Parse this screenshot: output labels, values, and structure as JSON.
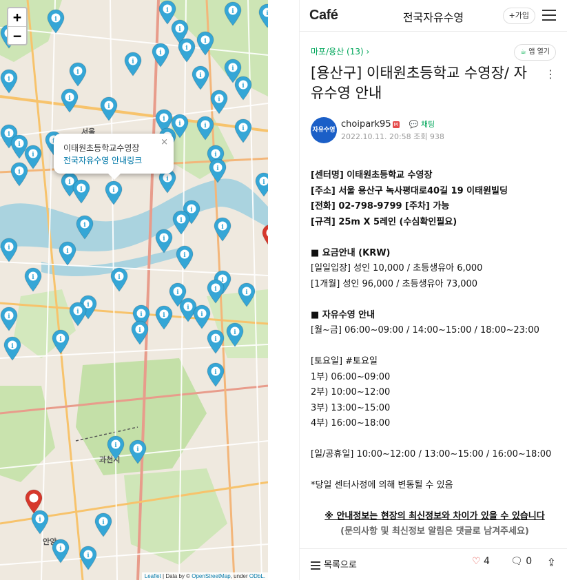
{
  "map": {
    "zoom_in": "+",
    "zoom_out": "−",
    "labels": {
      "seoul": "서울",
      "gwacheon": "과천시",
      "anyang": "안양"
    },
    "popup": {
      "line1": "이태원초등학교수영장",
      "line2": "전국자유수영 안내링크",
      "close": "×"
    },
    "attribution": {
      "leaflet": "Leaflet",
      "text": " | Data by © ",
      "osm": "OpenStreetMap",
      "under": ", under ",
      "odbl": "ODbL."
    },
    "marker_color": "#35a6d6",
    "selected_marker_color": "#d6382c"
  },
  "cafe": {
    "logo": "Café",
    "title": "전국자유수영",
    "join_label": "+가입",
    "board": "마포/용산 (13) ›",
    "open_app": "앱 열기",
    "post_title": "[용산구] 이태원초등학교 수영장/ 자유수영 안내",
    "avatar_text": "자유수영",
    "author": "choipark95",
    "author_badge": "M",
    "chat": "채팅",
    "date": "2022.10.11. 20:58 조회 938",
    "body": {
      "center": "[센터명] 이태원초등학교 수영장",
      "address": "[주소] 서울 용산구 녹사평대로40길 19 이태원빌딩",
      "phone": "[전화] 02-798-9799  [주차] 가능",
      "spec": "[규격] 25m X 5레인 (수심확인필요)",
      "fee_heading": "■ 요금안내 (KRW)",
      "fee_day": "[일일입장] 성인 10,000 / 초등생유아 6,000",
      "fee_month": "[1개월] 성인 96,000 / 초등생유아 73,000",
      "free_heading": "■ 자유수영 안내",
      "weekday": "[월~금] 06:00~09:00 / 14:00~15:00 / 18:00~23:00",
      "saturday": "[토요일] #토요일",
      "sat1": " 1부) 06:00~09:00",
      "sat2": " 2부) 10:00~12:00",
      "sat3": " 3부) 13:00~15:00",
      "sat4": " 4부) 16:00~18:00",
      "sunday": "[일/공휴일] 10:00~12:00 / 13:00~15:00 / 16:00~18:00",
      "note": "*당일 센터사정에 의해 변동될 수 있음",
      "notice": "※ 안내정보는 현장의 최신정보와 차이가 있을 수 있습니다",
      "notice2": "(문의사항 및 최신정보 알림은 댓글로 남겨주세요)"
    },
    "footer": {
      "list": "목록으로",
      "likes": "4",
      "comments": "0"
    },
    "accent": "#00a65a"
  }
}
